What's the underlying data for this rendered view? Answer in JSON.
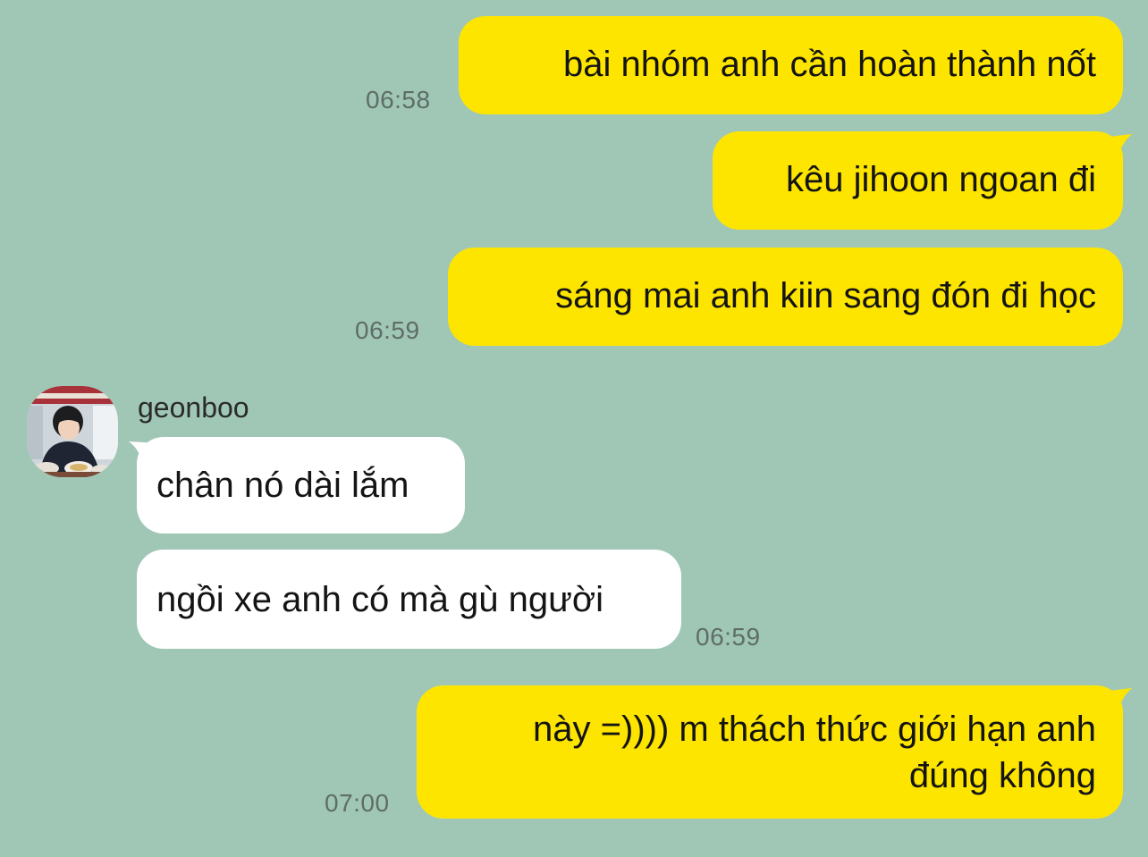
{
  "colors": {
    "background": "#a0c7b6",
    "outgoing_bubble": "#fee500",
    "incoming_bubble": "#ffffff",
    "timestamp": "#5e6d67"
  },
  "messages": [
    {
      "direction": "outgoing",
      "text": "bài nhóm anh cần hoàn thành nốt",
      "time": "06:58"
    },
    {
      "direction": "outgoing",
      "text": "kêu jihoon ngoan đi",
      "time": ""
    },
    {
      "direction": "outgoing",
      "text": "sáng mai anh kiin sang đón đi học",
      "time": "06:59"
    },
    {
      "direction": "incoming",
      "sender": "geonboo",
      "text": "chân nó dài lắm",
      "time": ""
    },
    {
      "direction": "incoming",
      "text": "ngồi xe anh có mà gù người",
      "time": "06:59"
    },
    {
      "direction": "outgoing",
      "text": "này =)))) m thách thức giới hạn anh đúng không",
      "time": "07:00"
    }
  ],
  "avatar": {
    "icon": "user-avatar-photo"
  }
}
